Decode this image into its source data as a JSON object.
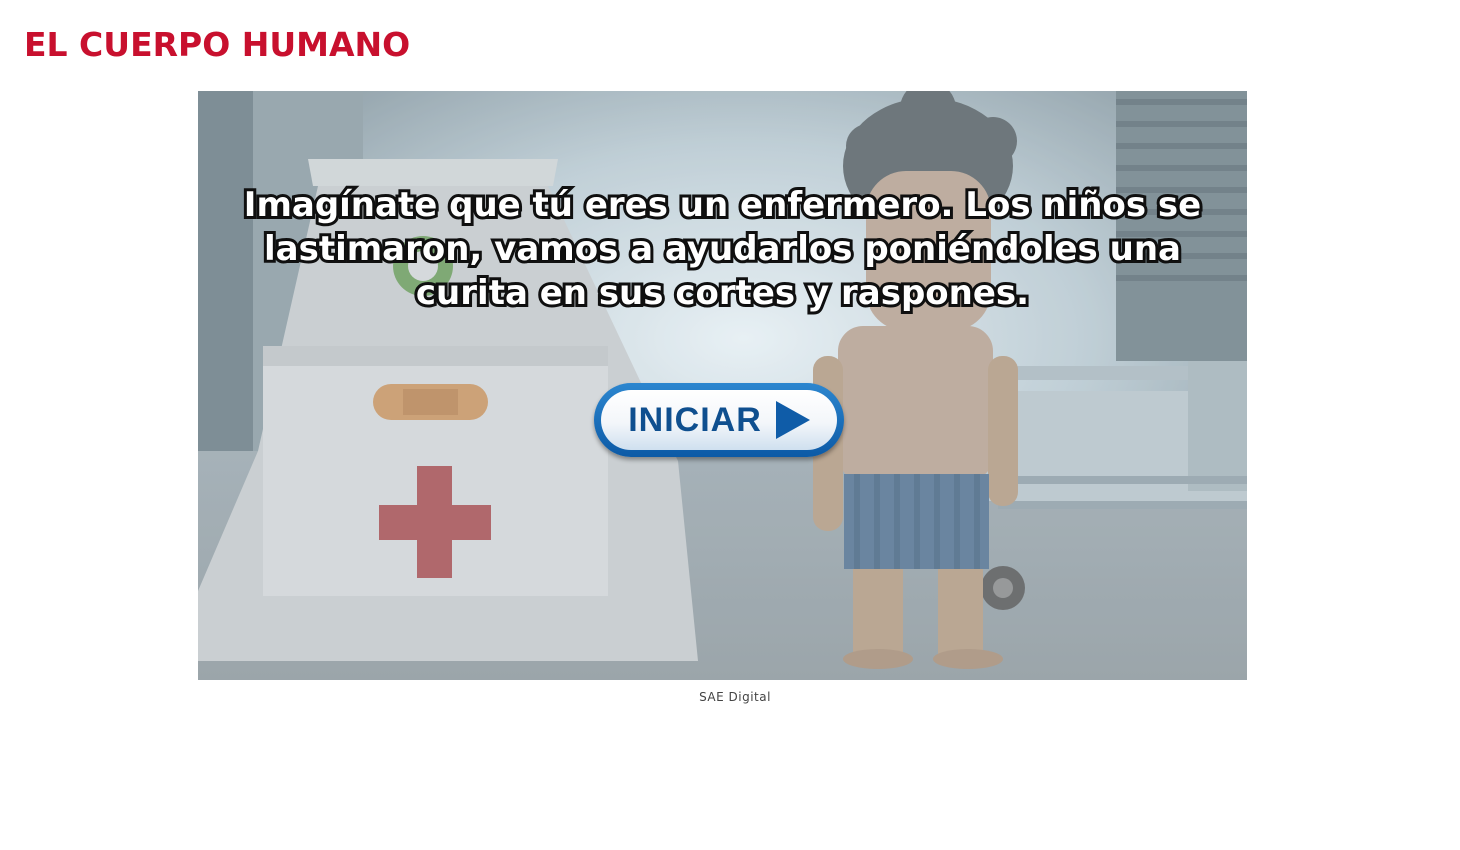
{
  "header": {
    "title": "EL CUERPO HUMANO"
  },
  "game": {
    "instructions": "Imagínate que tú eres un enfermero. Los niños se lastimaron, vamos a ayudarlos poniéndoles una curita en sus cortes y raspones.",
    "start_label": "INICIAR"
  },
  "footer": {
    "credit": "SAE Digital"
  },
  "colors": {
    "title": "#c8102e",
    "button_border": "#0c5aa6",
    "button_text": "#0f4f8f"
  },
  "icons": {
    "start": "play-icon",
    "kit": "red-cross-icon",
    "bandage": "bandage-icon"
  }
}
